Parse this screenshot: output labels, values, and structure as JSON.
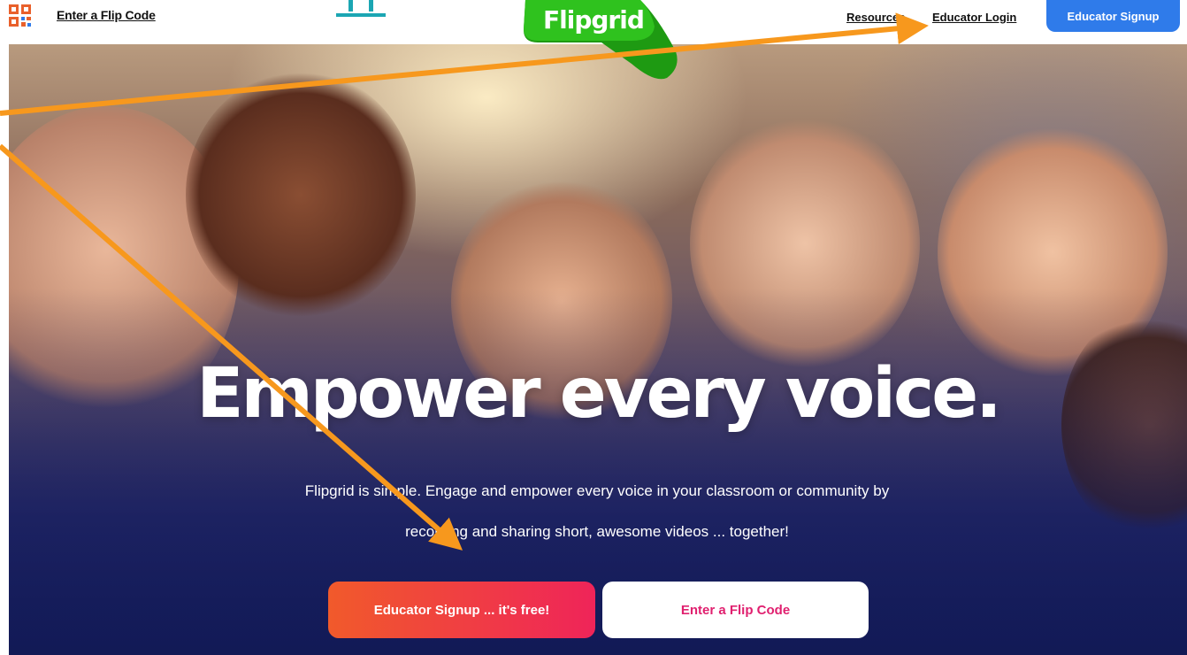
{
  "header": {
    "flip_code_link": "Enter a Flip Code",
    "logo_text": "Flipgrid",
    "nav": {
      "resources": "Resources",
      "educator_login": "Educator Login",
      "educator_signup": "Educator Signup"
    }
  },
  "hero": {
    "headline": "Empower every voice.",
    "subtext_line1": "Flipgrid is simple. Engage and empower every voice in your classroom or community by",
    "subtext_line2": "recording and sharing short, awesome videos ... together!",
    "cta_signup": "Educator Signup ... it's free!",
    "cta_code": "Enter a Flip Code"
  },
  "colors": {
    "brand_green": "#21b014",
    "signup_blue": "#2f7bea",
    "cta_gradient_start": "#f15a2b",
    "cta_gradient_end": "#ef2459",
    "cta_code_text": "#e0206f",
    "annotation_arrow": "#f7981d"
  },
  "icons": [
    "qr-code-icon",
    "cut-off-top-icon",
    "flipgrid-logo"
  ]
}
